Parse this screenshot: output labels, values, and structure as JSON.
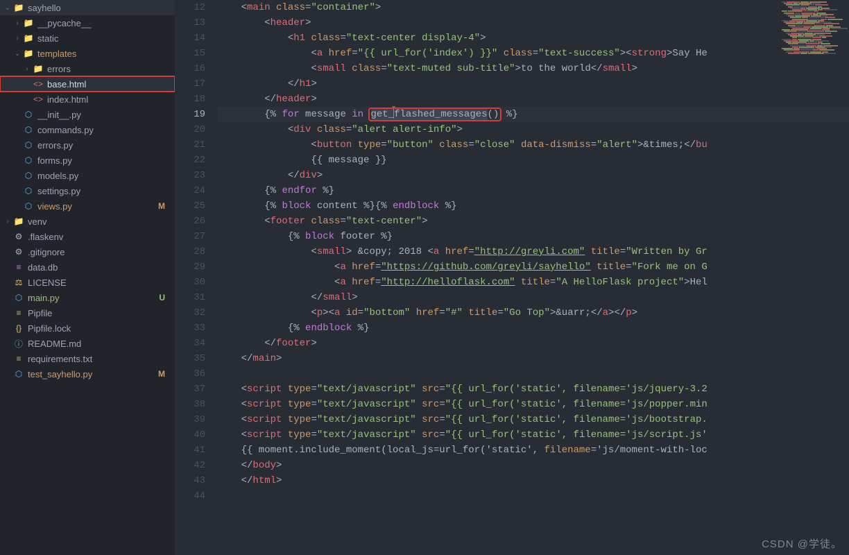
{
  "sidebar": {
    "items": [
      {
        "depth": 0,
        "name": "sayhello",
        "chev": "down",
        "icon": "folder",
        "state": ""
      },
      {
        "depth": 1,
        "name": "__pycache__",
        "chev": "right",
        "icon": "folder"
      },
      {
        "depth": 1,
        "name": "static",
        "chev": "right",
        "icon": "folder"
      },
      {
        "depth": 1,
        "name": "templates",
        "chev": "down",
        "icon": "folder",
        "state": "mod"
      },
      {
        "depth": 2,
        "name": "errors",
        "chev": "right",
        "icon": "folder"
      },
      {
        "depth": 2,
        "name": "base.html",
        "icon": "html",
        "selected": true
      },
      {
        "depth": 2,
        "name": "index.html",
        "icon": "html"
      },
      {
        "depth": 1,
        "name": "__init__.py",
        "icon": "py"
      },
      {
        "depth": 1,
        "name": "commands.py",
        "icon": "py"
      },
      {
        "depth": 1,
        "name": "errors.py",
        "icon": "py"
      },
      {
        "depth": 1,
        "name": "forms.py",
        "icon": "py"
      },
      {
        "depth": 1,
        "name": "models.py",
        "icon": "py"
      },
      {
        "depth": 1,
        "name": "settings.py",
        "icon": "py"
      },
      {
        "depth": 1,
        "name": "views.py",
        "icon": "py",
        "state": "mod",
        "status": "M"
      },
      {
        "depth": 0,
        "name": "venv",
        "chev": "right",
        "icon": "folder"
      },
      {
        "depth": 0,
        "name": ".flaskenv",
        "icon": "cfg"
      },
      {
        "depth": 0,
        "name": ".gitignore",
        "icon": "cfg"
      },
      {
        "depth": 0,
        "name": "data.db",
        "icon": "db"
      },
      {
        "depth": 0,
        "name": "LICENSE",
        "icon": "lic"
      },
      {
        "depth": 0,
        "name": "main.py",
        "icon": "py",
        "state": "new",
        "status": "U"
      },
      {
        "depth": 0,
        "name": "Pipfile",
        "icon": "txt"
      },
      {
        "depth": 0,
        "name": "Pipfile.lock",
        "icon": "lock"
      },
      {
        "depth": 0,
        "name": "README.md",
        "icon": "info"
      },
      {
        "depth": 0,
        "name": "requirements.txt",
        "icon": "txt"
      },
      {
        "depth": 0,
        "name": "test_sayhello.py",
        "icon": "py",
        "state": "mod",
        "status": "M"
      }
    ]
  },
  "editor": {
    "first_line": 12,
    "active_line": 19,
    "lines": [
      "    <main class=\"container\">",
      "        <header>",
      "            <h1 class=\"text-center display-4\">",
      "                <a href=\"{{ url_for('index') }}\" class=\"text-success\"><strong>Say He",
      "                <small class=\"text-muted sub-title\">to the world</small>",
      "            </h1>",
      "        </header>",
      "        {% for message in get_flashed_messages() %}",
      "            <div class=\"alert alert-info\">",
      "                <button type=\"button\" class=\"close\" data-dismiss=\"alert\">&times;</bu",
      "                {{ message }}",
      "            </div>",
      "        {% endfor %}",
      "        {% block content %}{% endblock %}",
      "        <footer class=\"text-center\">",
      "            {% block footer %}",
      "                <small> &copy; 2018 <a href=\"http://greyli.com\" title=\"Written by Gr",
      "                    <a href=\"https://github.com/greyli/sayhello\" title=\"Fork me on G",
      "                    <a href=\"http://helloflask.com\" title=\"A HelloFlask project\">Hel",
      "                </small>",
      "                <p><a id=\"bottom\" href=\"#\" title=\"Go Top\">&uarr;</a></p>",
      "            {% endblock %}",
      "        </footer>",
      "    </main>",
      "",
      "    <script type=\"text/javascript\" src=\"{{ url_for('static', filename='js/jquery-3.2",
      "    <script type=\"text/javascript\" src=\"{{ url_for('static', filename='js/popper.min",
      "    <script type=\"text/javascript\" src=\"{{ url_for('static', filename='js/bootstrap.",
      "    <script type=\"text/javascript\" src=\"{{ url_for('static', filename='js/script.js'",
      "    {{ moment.include_moment(local_js=url_for('static', filename='js/moment-with-loc",
      "    </body>",
      "    </html>",
      ""
    ],
    "highlight_text": "get_flashed_messages()"
  },
  "watermark": "CSDN @学徒。",
  "icons": {
    "folder": "📁",
    "html": "<>",
    "py": "⬡",
    "txt": "≡",
    "cfg": "⚙",
    "db": "≡",
    "lic": "⚖",
    "info": "ⓘ",
    "lock": "{}"
  }
}
